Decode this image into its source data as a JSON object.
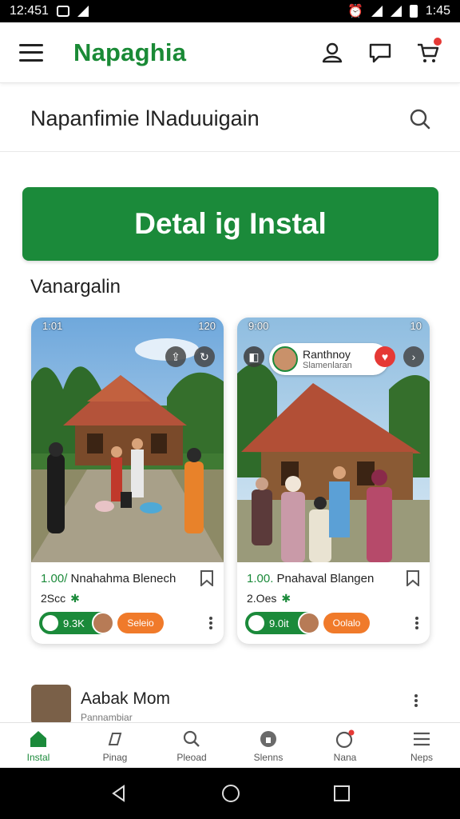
{
  "status_bar": {
    "time": "12:451",
    "right_time": "1:45"
  },
  "app_bar": {
    "brand": "Napaghia"
  },
  "search": {
    "placeholder": "Napanfimie lNaduuigain"
  },
  "cta": {
    "label": "Detal ig Instal"
  },
  "section": {
    "title": "Vanargalin"
  },
  "cards": [
    {
      "mini_status": {
        "left": "1:01",
        "right": "120"
      },
      "price": "1.00/",
      "title": "Nnahahma Blenech",
      "count": "2Scc",
      "pill_label": "9.3K",
      "action_label": "Seleio"
    },
    {
      "mini_status": {
        "left": "9:00",
        "right": "10"
      },
      "chip_title": "Ranthnoy",
      "chip_sub": "Slamenlaran",
      "price": "1.00.",
      "title": "Pnahaval Blangen",
      "count": "2.Oes",
      "pill_label": "9.0it",
      "action_label": "Oolalo"
    }
  ],
  "post": {
    "name": "Aabak Mom",
    "subtitle": "Pannambiar"
  },
  "bottom_nav": [
    {
      "label": "Instal",
      "icon": "home-icon"
    },
    {
      "label": "Pinag",
      "icon": "pin-icon"
    },
    {
      "label": "Pleoad",
      "icon": "search-icon"
    },
    {
      "label": "Slenns",
      "icon": "lock-icon"
    },
    {
      "label": "Nana",
      "icon": "notification-icon"
    },
    {
      "label": "Neps",
      "icon": "menu-icon"
    }
  ],
  "colors": {
    "brand": "#1b8a3a",
    "orange": "#f07a2a",
    "badge": "#e53935"
  }
}
